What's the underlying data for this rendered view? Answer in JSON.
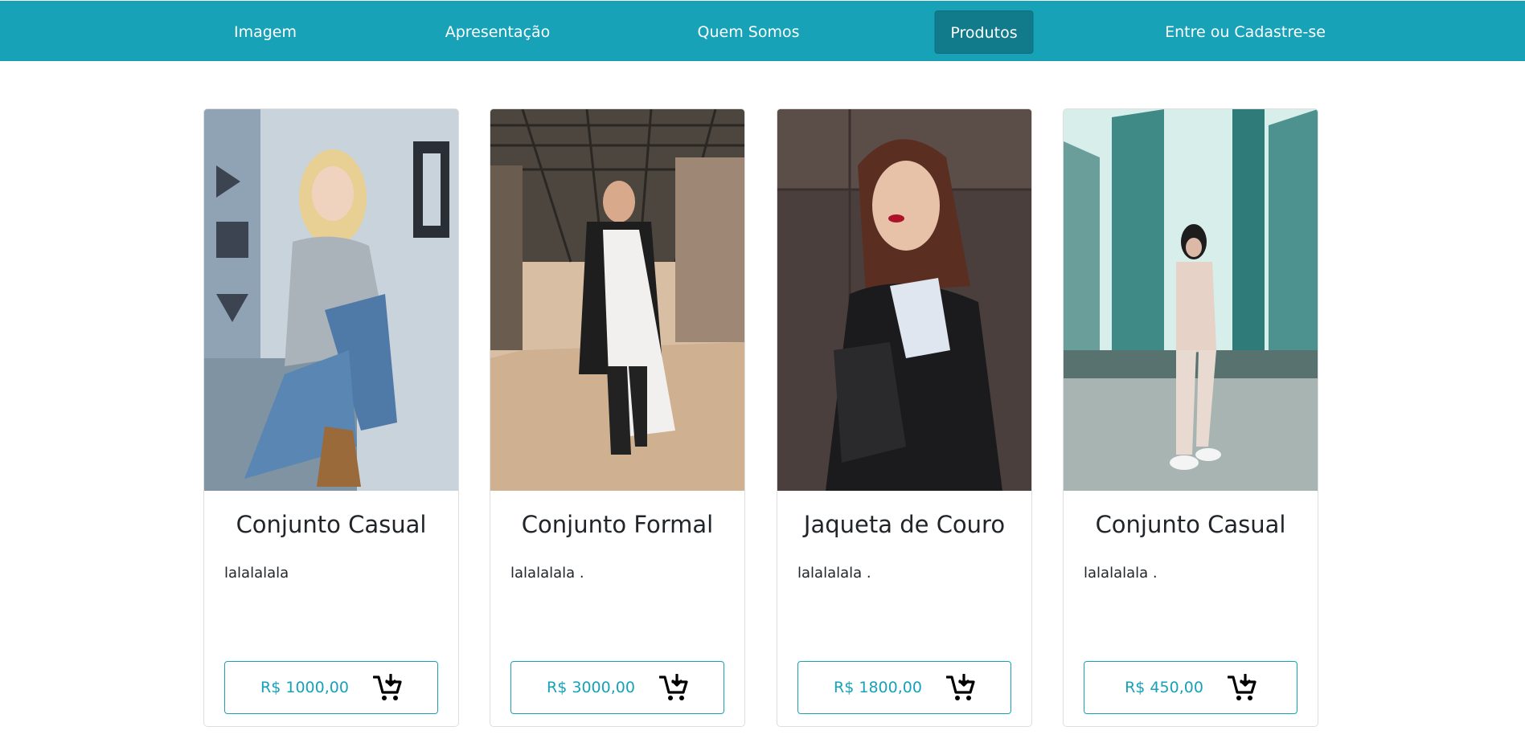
{
  "nav": {
    "items": [
      {
        "label": "Imagem"
      },
      {
        "label": "Apresentação"
      },
      {
        "label": "Quem Somos"
      },
      {
        "label": "Produtos"
      },
      {
        "label": "Entre ou Cadastre-se"
      }
    ]
  },
  "colors": {
    "nav_bg": "#17a2b8",
    "nav_active": "#117a8b",
    "accent": "#17a2b8"
  },
  "products": [
    {
      "title": "Conjunto Casual",
      "description": "lalalalala",
      "price": "R$ 1000,00",
      "icon": "add-to-cart-icon"
    },
    {
      "title": "Conjunto Formal",
      "description": "lalalalala .",
      "price": "R$ 3000,00",
      "icon": "add-to-cart-icon"
    },
    {
      "title": "Jaqueta de Couro",
      "description": "lalalalala .",
      "price": "R$ 1800,00",
      "icon": "add-to-cart-icon"
    },
    {
      "title": "Conjunto Casual",
      "description": "lalalalala .",
      "price": "R$ 450,00",
      "icon": "add-to-cart-icon"
    }
  ]
}
